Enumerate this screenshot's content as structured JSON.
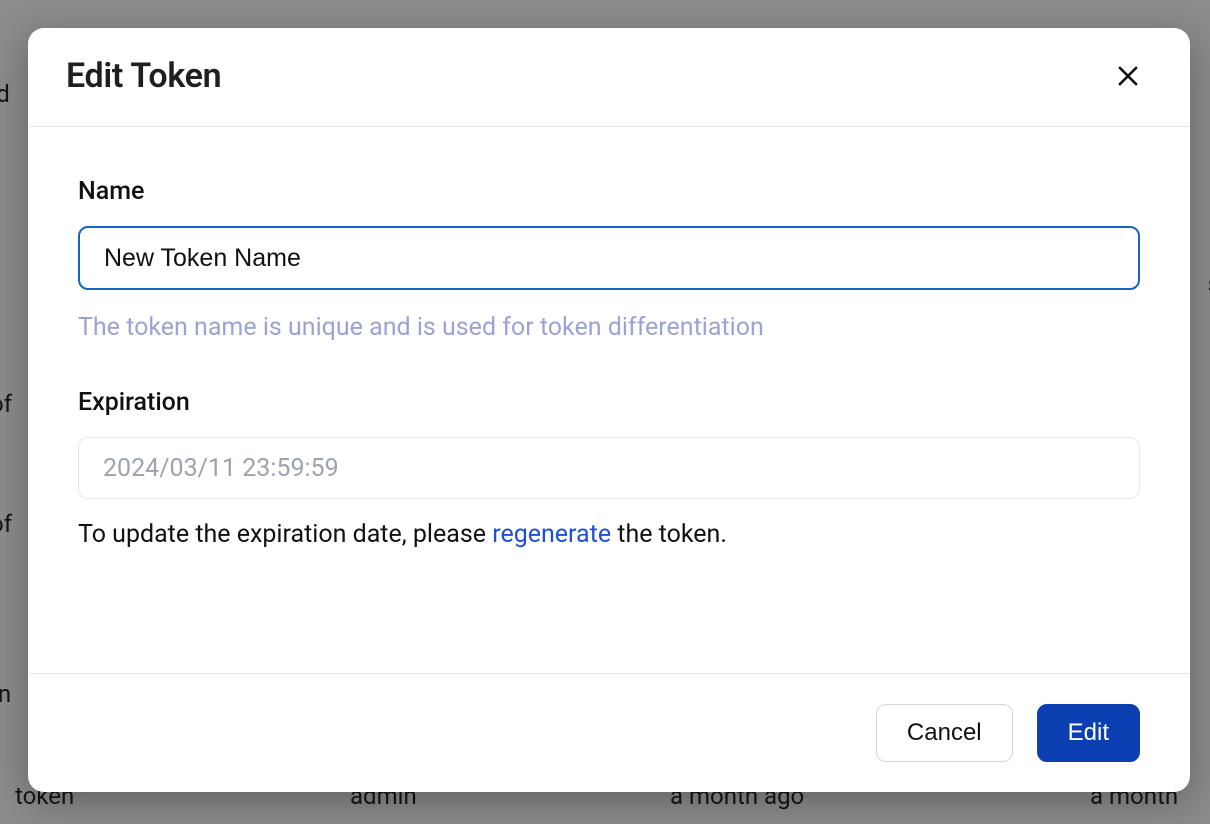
{
  "modal": {
    "title": "Edit Token",
    "name_label": "Name",
    "name_value": "New Token Name",
    "name_helper": "The token name is unique and is used for token differentiation",
    "expiration_label": "Expiration",
    "expiration_value": "2024/03/11 23:59:59",
    "expiration_prefix": "To update the expiration date, please ",
    "regenerate_label": "regenerate",
    "expiration_suffix": " the token.",
    "cancel_label": "Cancel",
    "edit_label": "Edit"
  },
  "background": {
    "row_user": "admin",
    "row_date": "a month ago",
    "token_word": "token"
  }
}
